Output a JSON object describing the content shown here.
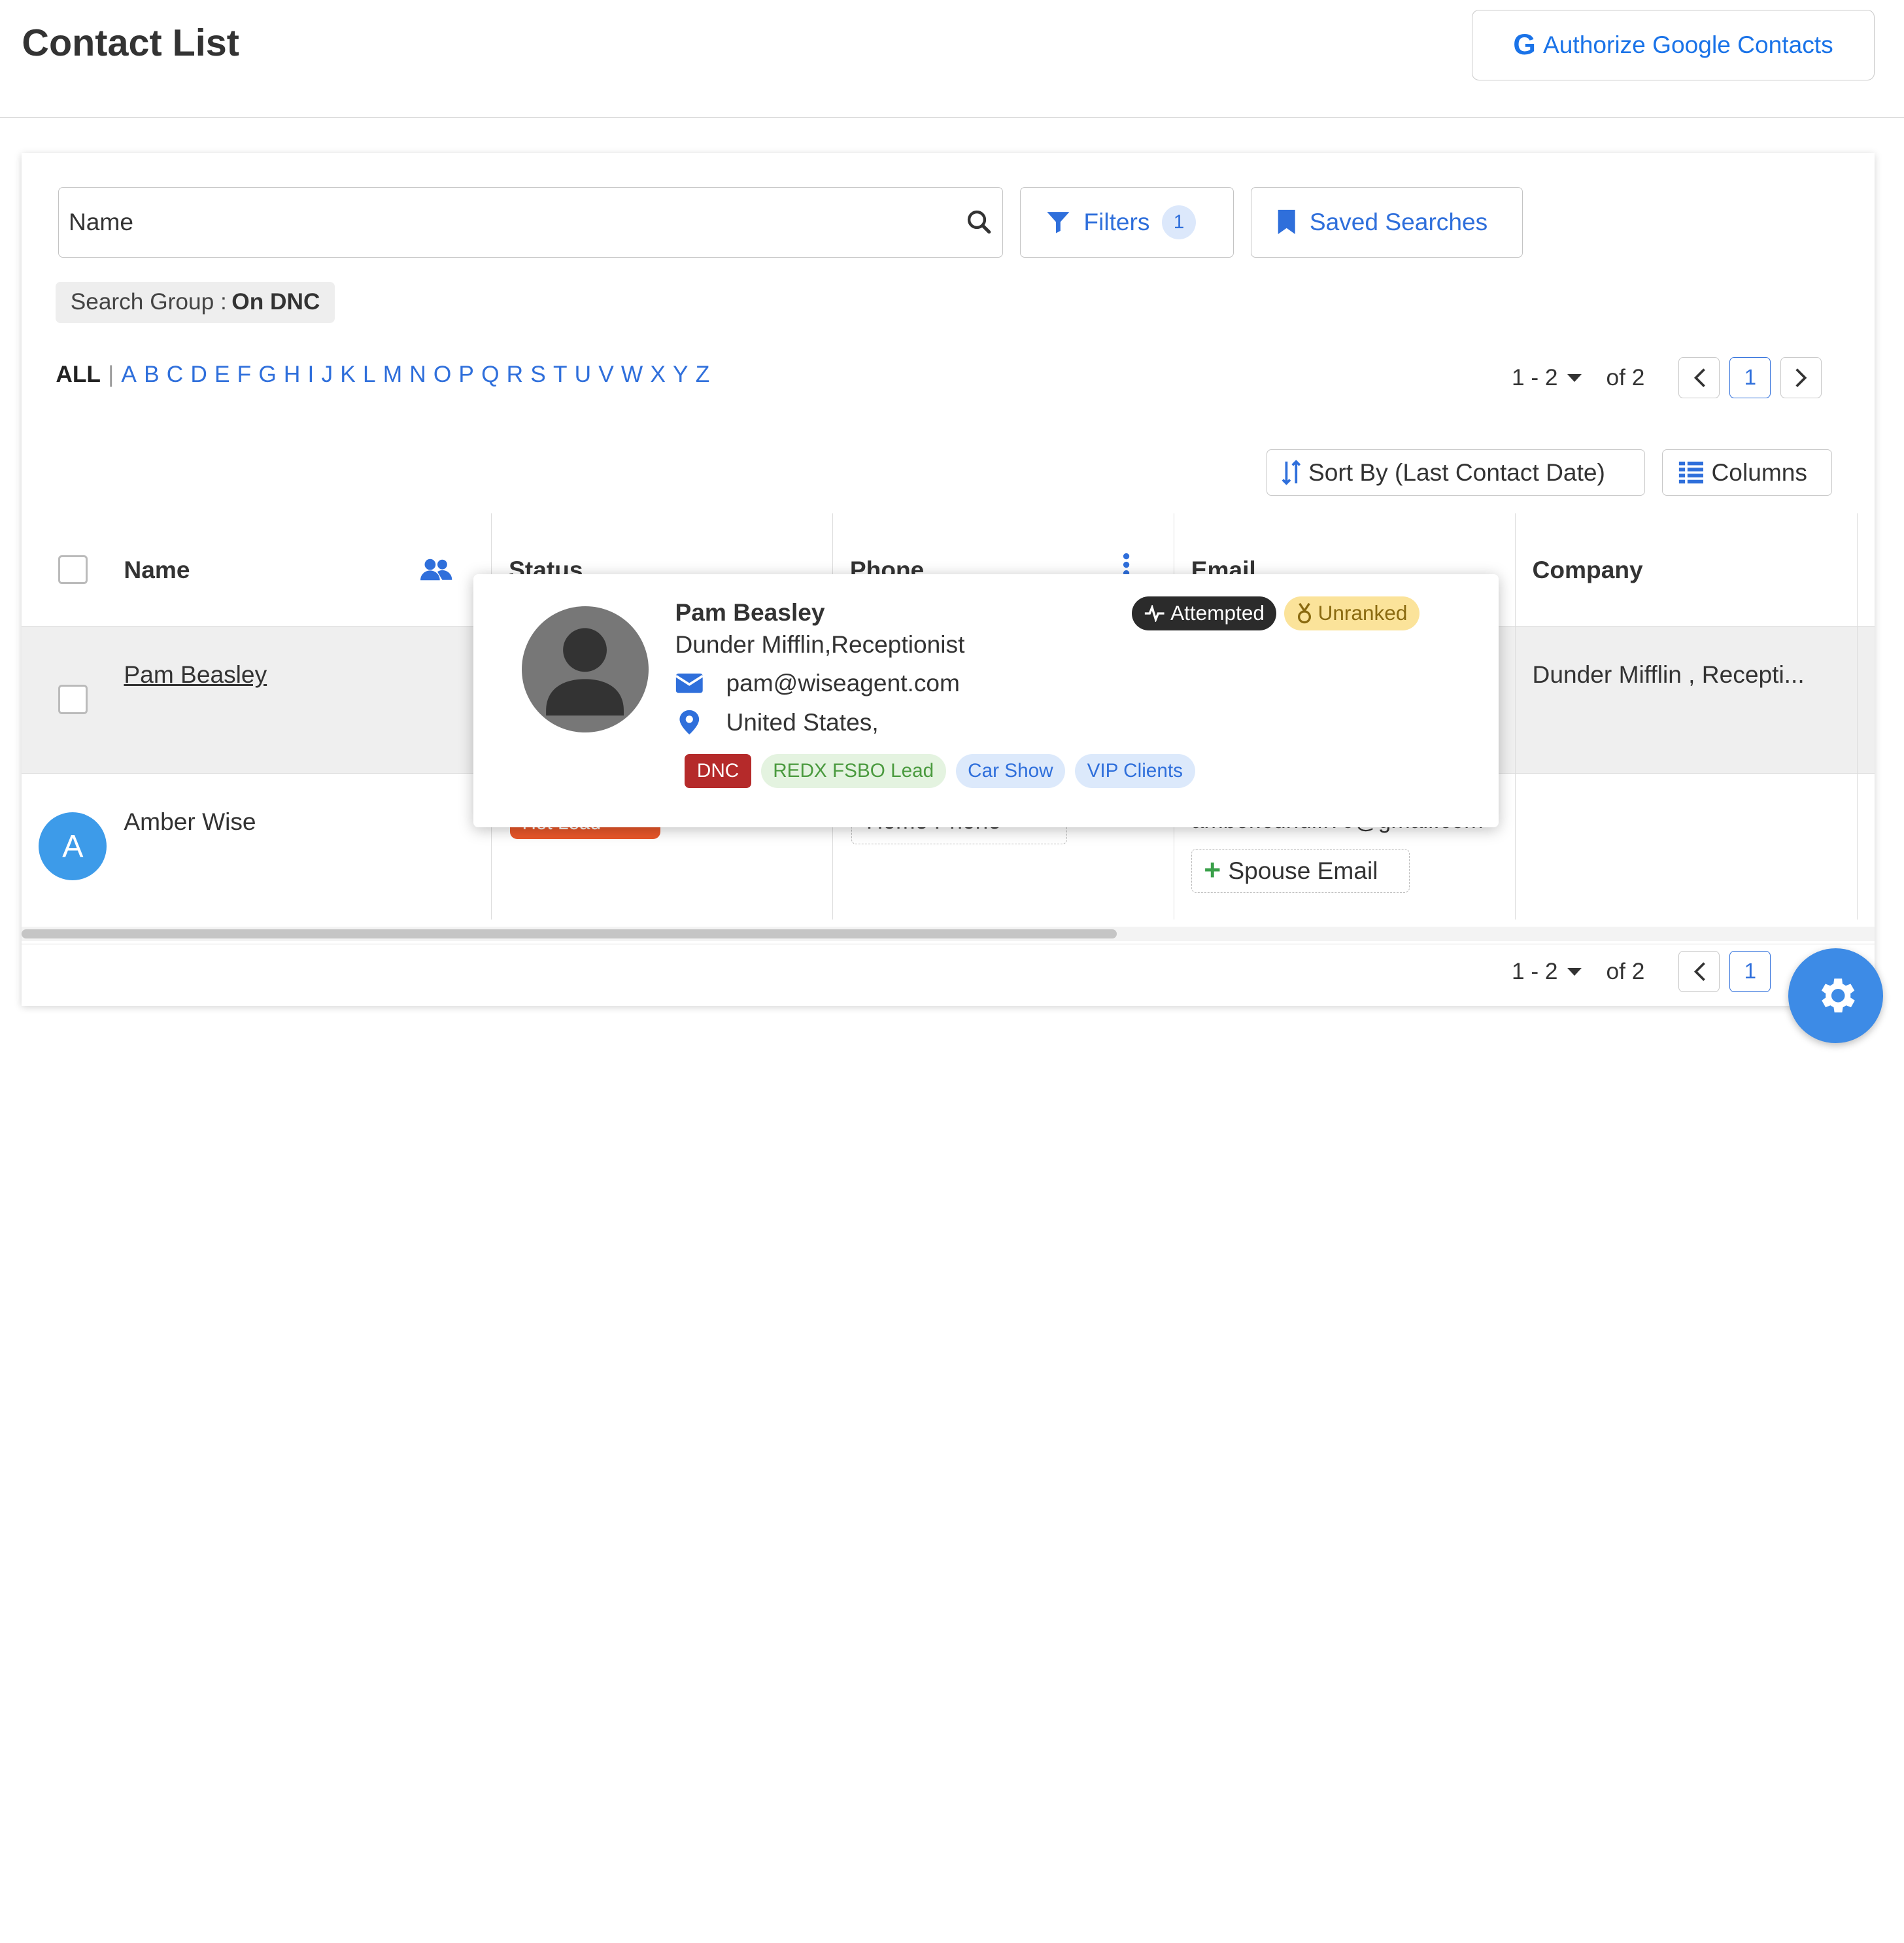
{
  "header": {
    "title": "Contact List",
    "google_button": {
      "icon": "google-g-icon",
      "g": "G",
      "label": "Authorize Google Contacts"
    }
  },
  "search": {
    "placeholder": "Name",
    "value": ""
  },
  "filters": {
    "label": "Filters",
    "count": "1"
  },
  "saved_searches": {
    "label": "Saved Searches"
  },
  "search_group": {
    "prefix": "Search Group :",
    "value": "On DNC"
  },
  "alphabet": {
    "all": "ALL",
    "separator": "|",
    "letters": [
      "A",
      "B",
      "C",
      "D",
      "E",
      "F",
      "G",
      "H",
      "I",
      "J",
      "K",
      "L",
      "M",
      "N",
      "O",
      "P",
      "Q",
      "R",
      "S",
      "T",
      "U",
      "V",
      "W",
      "X",
      "Y",
      "Z"
    ]
  },
  "pagination": {
    "range": "1 - 2",
    "of": "of 2",
    "current_page": "1"
  },
  "sort_button": {
    "label": "Sort By (Last Contact Date)"
  },
  "columns_button": {
    "label": "Columns"
  },
  "table": {
    "columns": [
      "Name",
      "Status",
      "Phone",
      "Email",
      "Company"
    ],
    "rows": [
      {
        "name": "Pam Beasley",
        "company": "Dunder Mifflin , Recepti..."
      },
      {
        "avatar_letter": "A",
        "name": "Amber Wise",
        "status": "Hot Lead",
        "phone": "Home Phone",
        "email": "amber.cundiff79@gmail.com",
        "spouse_email_label": "Spouse Email"
      }
    ]
  },
  "popup": {
    "name": "Pam Beasley",
    "role": "Dunder Mifflin,Receptionist",
    "email": "pam@wiseagent.com",
    "location": "United States,",
    "status_badge": "Attempted",
    "rank_badge": "Unranked",
    "tags": [
      "DNC",
      "REDX FSBO Lead",
      "Car Show",
      "VIP Clients"
    ]
  },
  "colors": {
    "accent": "#2f6fdb",
    "dnc": "#b52a2a",
    "hot_lead": "#e8572a",
    "fab": "#3d8be6"
  }
}
